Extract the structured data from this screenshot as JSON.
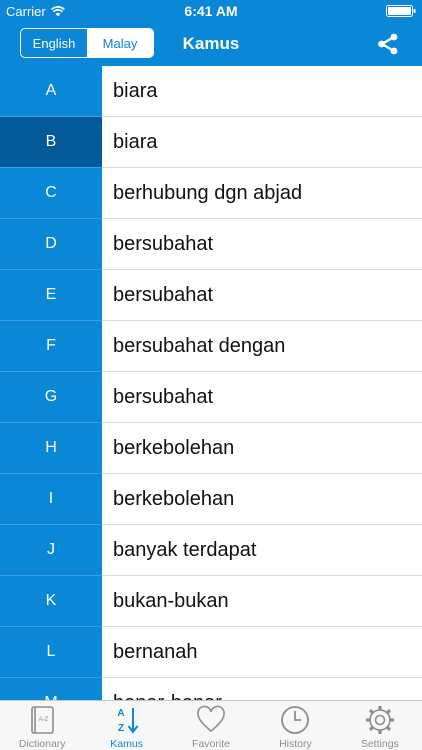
{
  "status": {
    "carrier": "Carrier",
    "time": "6:41 AM"
  },
  "nav": {
    "segment": [
      "English",
      "Malay"
    ],
    "active_segment": "Malay",
    "title": "Kamus"
  },
  "rows": [
    {
      "letter": "A",
      "word": "biara"
    },
    {
      "letter": "B",
      "word": "biara"
    },
    {
      "letter": "C",
      "word": "berhubung dgn abjad"
    },
    {
      "letter": "D",
      "word": "bersubahat"
    },
    {
      "letter": "E",
      "word": "bersubahat"
    },
    {
      "letter": "F",
      "word": "bersubahat dengan"
    },
    {
      "letter": "G",
      "word": "bersubahat"
    },
    {
      "letter": "H",
      "word": "berkebolehan"
    },
    {
      "letter": "I",
      "word": "berkebolehan"
    },
    {
      "letter": "J",
      "word": "banyak terdapat"
    },
    {
      "letter": "K",
      "word": "bukan-bukan"
    },
    {
      "letter": "L",
      "word": "bernanah"
    },
    {
      "letter": "M",
      "word": "benar-benar"
    }
  ],
  "selected_letter": "B",
  "tabs": [
    {
      "label": "Dictionary",
      "icon": "dictionary-icon"
    },
    {
      "label": "Kamus",
      "icon": "az-sort-icon"
    },
    {
      "label": "Favorite",
      "icon": "heart-icon"
    },
    {
      "label": "History",
      "icon": "clock-icon"
    },
    {
      "label": "Settings",
      "icon": "gear-icon"
    }
  ],
  "active_tab": "Kamus",
  "colors": {
    "primary": "#0a87d6",
    "selected_row": "#045a98",
    "tab_inactive": "#8e8e8e"
  }
}
